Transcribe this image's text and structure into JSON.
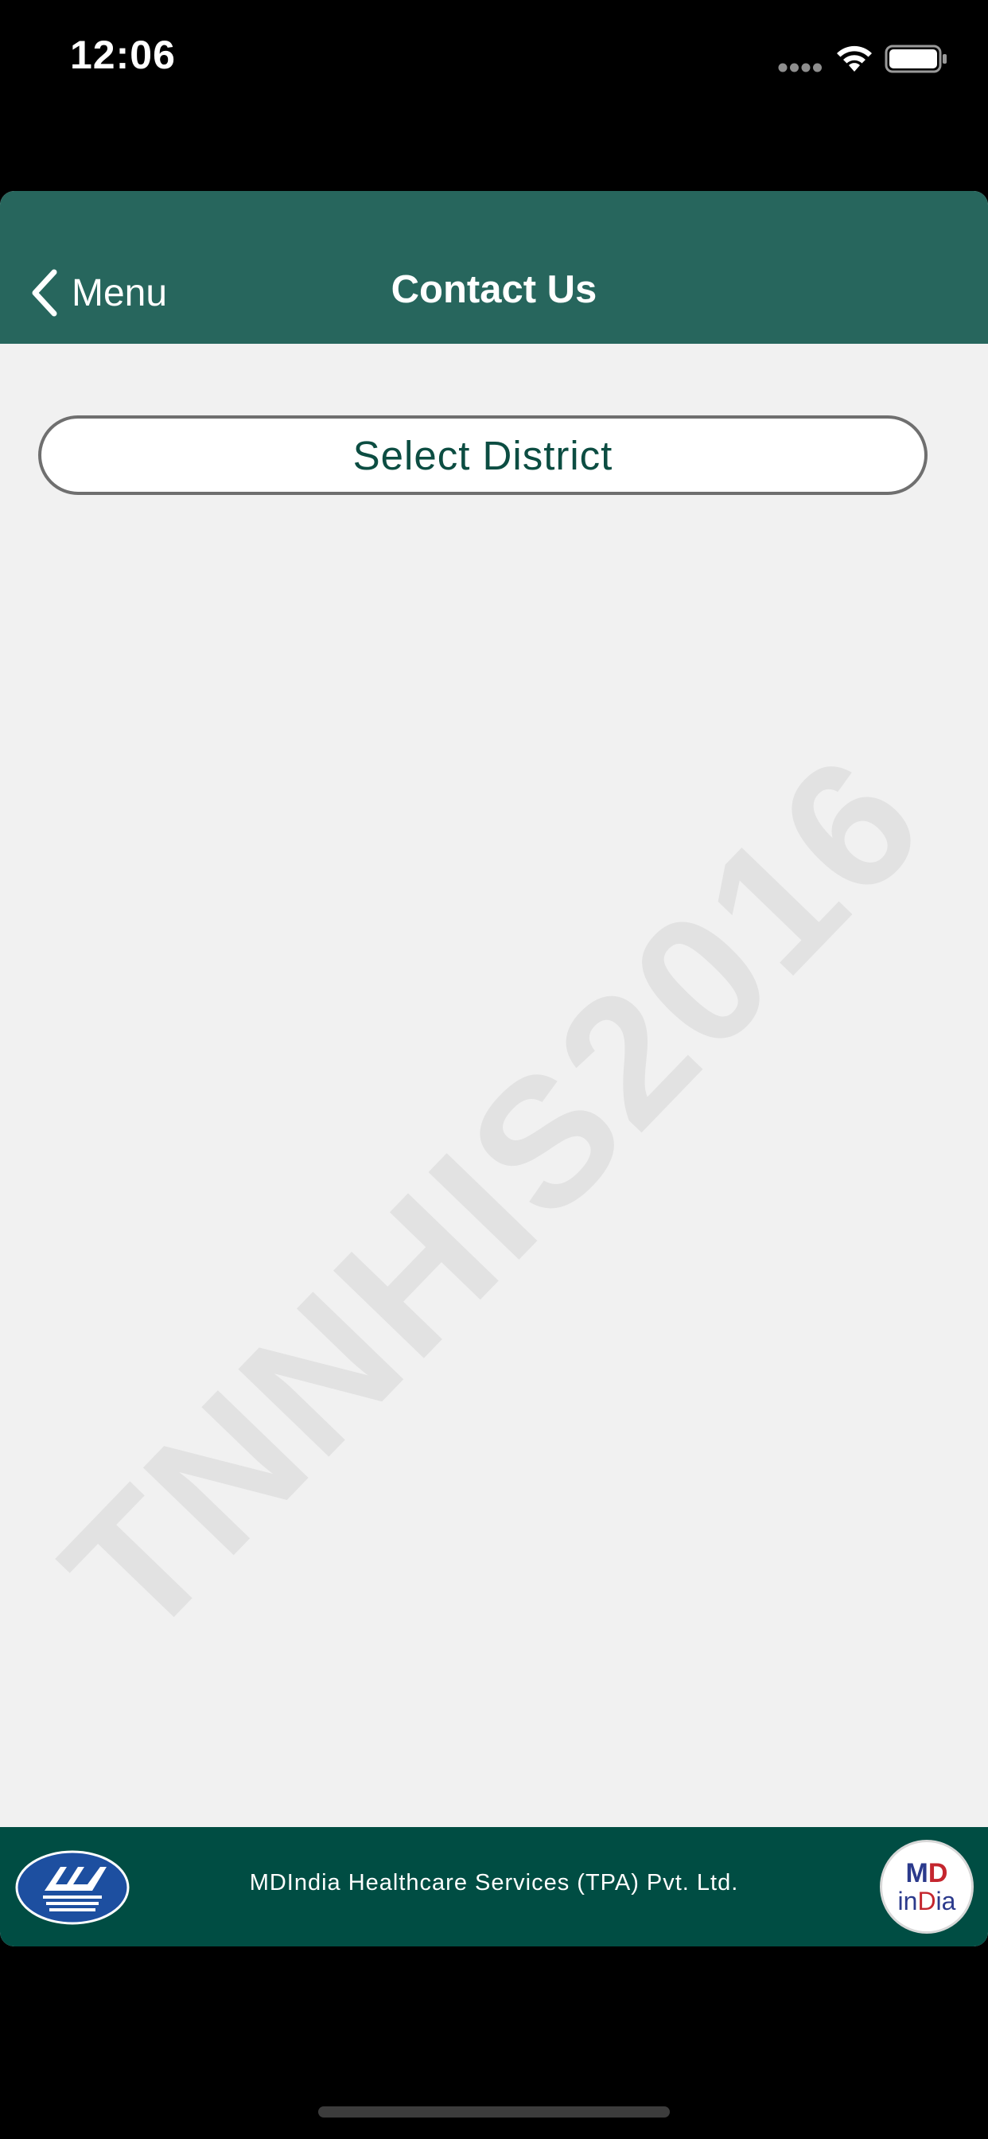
{
  "status_bar": {
    "time": "12:06",
    "icons": [
      "signal-dots-icon",
      "wifi-icon",
      "battery-icon"
    ]
  },
  "header": {
    "back_label": "Menu",
    "back_icon": "chevron-left-icon",
    "title": "Contact Us",
    "background_color": "#27665d"
  },
  "content": {
    "select_district_label": "Select District",
    "watermark": "TNNHIS2016",
    "background_color": "#f1f1f1"
  },
  "footer": {
    "left_logo": "united-india-logo",
    "text": "MDIndia Healthcare Services (TPA) Pvt. Ltd.",
    "right_logo": "mdindia-logo",
    "right_logo_text_top_1": "M",
    "right_logo_text_top_2": "D",
    "right_logo_text_bottom_1": "in",
    "right_logo_text_bottom_2": "D",
    "right_logo_text_bottom_3": "ia",
    "background_color": "#004d43"
  }
}
